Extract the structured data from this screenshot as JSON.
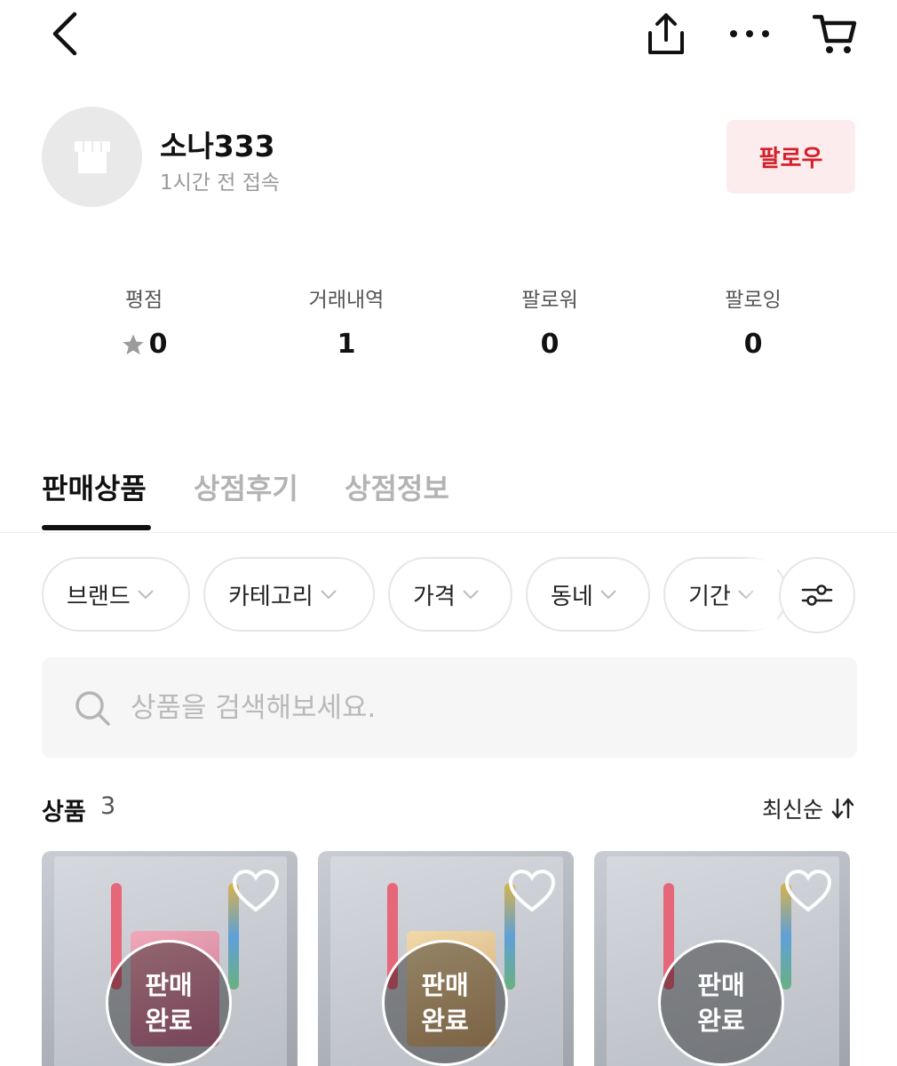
{
  "topbar": {
    "icons": [
      "back-arrow-icon",
      "share-icon",
      "more-icon",
      "cart-icon"
    ]
  },
  "profile": {
    "name": "소나333",
    "last_seen": "1시간 전 접속",
    "follow_label": "팔로우",
    "avatar_icon": "store-icon"
  },
  "stats": [
    {
      "label": "평점",
      "value": "0",
      "icon": "star-icon"
    },
    {
      "label": "거래내역",
      "value": "1"
    },
    {
      "label": "팔로워",
      "value": "0"
    },
    {
      "label": "팔로잉",
      "value": "0"
    }
  ],
  "tabs": [
    {
      "label": "판매상품",
      "active": true
    },
    {
      "label": "상점후기",
      "active": false
    },
    {
      "label": "상점정보",
      "active": false
    }
  ],
  "filters": [
    {
      "label": "브랜드"
    },
    {
      "label": "카테고리"
    },
    {
      "label": "가격"
    },
    {
      "label": "동네"
    },
    {
      "label": "기간"
    }
  ],
  "search": {
    "placeholder": "상품을 검색해보세요."
  },
  "list": {
    "title": "상품",
    "count": "3",
    "sort_label": "최신순"
  },
  "products": [
    {
      "status_line1": "판매",
      "status_line2": "완료"
    },
    {
      "status_line1": "판매",
      "status_line2": "완료"
    },
    {
      "status_line1": "판매",
      "status_line2": "완료"
    }
  ],
  "colors": {
    "accent": "#d5202c",
    "follow_bg": "#fdeced",
    "muted_text": "#9a9a9a"
  }
}
